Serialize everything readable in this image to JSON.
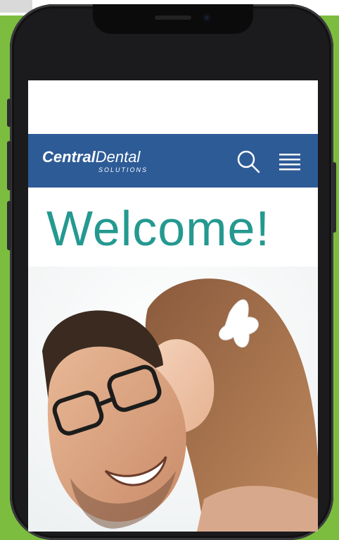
{
  "header": {
    "logo_bold": "Central",
    "logo_regular": "Dental",
    "logo_subtitle": "SOLUTIONS"
  },
  "main": {
    "heading": "Welcome!"
  },
  "icons": {
    "search": "search-icon",
    "menu": "hamburger-menu-icon"
  },
  "colors": {
    "background": "#7cbd3f",
    "header": "#2d5b96",
    "heading": "#249990",
    "phone_frame": "#1b1a1d"
  }
}
